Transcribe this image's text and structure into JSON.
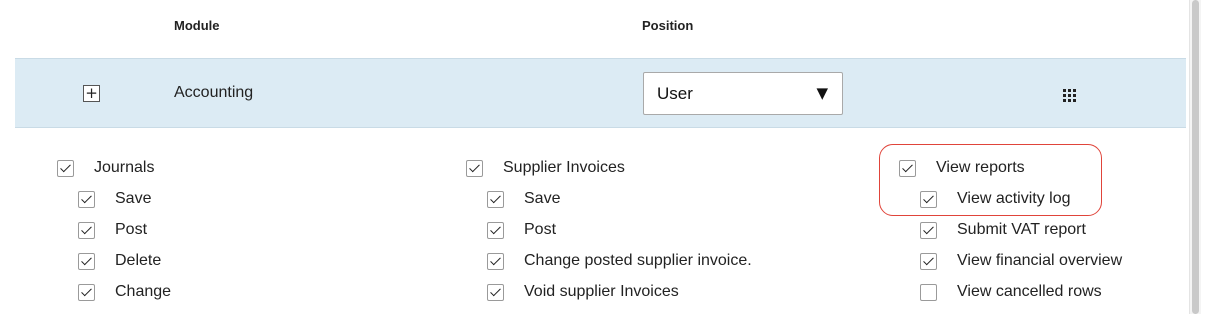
{
  "table": {
    "header_module": "Module",
    "header_position": "Position"
  },
  "module_row": {
    "expand_symbol": "+",
    "name": "Accounting",
    "position_value": "User",
    "dropdown_arrow": "▼"
  },
  "permissions": {
    "col1": [
      {
        "label": "Journals",
        "checked": true,
        "level": 0
      },
      {
        "label": "Save",
        "checked": true,
        "level": 1
      },
      {
        "label": "Post",
        "checked": true,
        "level": 1
      },
      {
        "label": "Delete",
        "checked": true,
        "level": 1
      },
      {
        "label": "Change",
        "checked": true,
        "level": 1
      }
    ],
    "col2": [
      {
        "label": "Supplier Invoices",
        "checked": true,
        "level": 0
      },
      {
        "label": "Save",
        "checked": true,
        "level": 1
      },
      {
        "label": "Post",
        "checked": true,
        "level": 1
      },
      {
        "label": "Change posted supplier invoice.",
        "checked": true,
        "level": 1
      },
      {
        "label": "Void supplier Invoices",
        "checked": true,
        "level": 1
      }
    ],
    "col3": [
      {
        "label": "View reports",
        "checked": true,
        "level": 0
      },
      {
        "label": "View activity log",
        "checked": true,
        "level": 1
      },
      {
        "label": "Submit VAT report",
        "checked": true,
        "level": 1
      },
      {
        "label": "View financial overview",
        "checked": true,
        "level": 1
      },
      {
        "label": "View cancelled rows",
        "checked": false,
        "level": 1
      }
    ]
  },
  "colors": {
    "row_highlight": "#dcebf4",
    "annotation_border": "#e0443a"
  },
  "icons": {
    "expand": "plus-square-icon",
    "grid": "grid-dots-icon",
    "checkbox": "checkmark-icon"
  }
}
